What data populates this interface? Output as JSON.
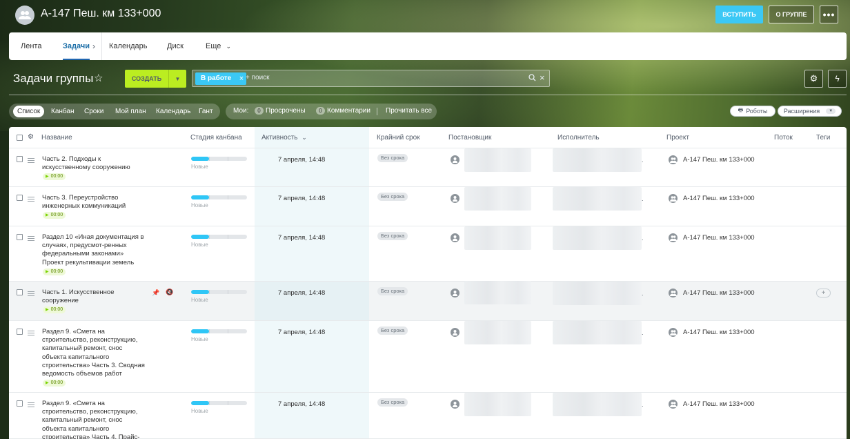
{
  "group": {
    "title": "А-147 Пеш. км 133+000",
    "join_label": "ВСТУПИТЬ",
    "about_label": "О ГРУППЕ",
    "more_label": "•••"
  },
  "nav": {
    "items": [
      "Лента",
      "Задачи",
      "Календарь",
      "Диск",
      "Еще"
    ],
    "active": "Задачи"
  },
  "page": {
    "title": "Задачи группы",
    "create_label": "СОЗДАТЬ"
  },
  "filter": {
    "chip_label": "В работе",
    "placeholder": "+ поиск"
  },
  "views": {
    "items": [
      "Список",
      "Канбан",
      "Сроки",
      "Мой план",
      "Календарь",
      "Гант"
    ],
    "active": "Список"
  },
  "counters": {
    "label": "Мои:",
    "overdue": {
      "count": "0",
      "label": "Просрочены"
    },
    "comments": {
      "count": "0",
      "label": "Комментарии"
    },
    "read_all": "Прочитать все"
  },
  "toolbar": {
    "robots_label": "Роботы",
    "extensions_label": "Расширения"
  },
  "columns": {
    "name": "Название",
    "kanban_stage": "Стадия канбана",
    "activity": "Активность",
    "deadline": "Крайний срок",
    "creator": "Постановщик",
    "responsible": "Исполнитель",
    "project": "Проект",
    "flow": "Поток",
    "tags": "Теги"
  },
  "tasks": [
    {
      "title": "Часть 2. Подходы к искусственному сооружению",
      "timer": "00:00",
      "stage": "Новые",
      "activity": "7 апреля, 14:48",
      "deadline": "Без срока",
      "project": "А-147 Пеш. км 133+000"
    },
    {
      "title": "Часть 3. Переустройство инженерных коммуникаций",
      "timer": "00:00",
      "stage": "Новые",
      "activity": "7 апреля, 14:48",
      "deadline": "Без срока",
      "project": "А-147 Пеш. км 133+000"
    },
    {
      "title": "Раздел 10 «Иная документация в случаях, предусмот-ренных федеральными законами» Проект рекультивации земель",
      "timer": "00:00",
      "stage": "Новые",
      "activity": "7 апреля, 14:48",
      "deadline": "Без срока",
      "project": "А-147 Пеш. км 133+000"
    },
    {
      "title": "Часть 1. Искусственное сооружение",
      "timer": "00:00",
      "stage": "Новые",
      "activity": "7 апреля, 14:48",
      "deadline": "Без срока",
      "project": "А-147 Пеш. км 133+000"
    },
    {
      "title": "Раздел 9. «Смета на строительство, реконструкцию, капитальный ремонт, снос объекта капитального строительства» Часть 3. Сводная ведомость объемов работ",
      "timer": "00:00",
      "stage": "Новые",
      "activity": "7 апреля, 14:48",
      "deadline": "Без срока",
      "project": "А-147 Пеш. км 133+000"
    },
    {
      "title": "Раздел 9. «Смета на строительство, реконструкцию, капитальный ремонт, снос объекта капитального строительства» Часть 4. Прайс-",
      "timer": "",
      "stage": "Новые",
      "activity": "7 апреля, 14:48",
      "deadline": "Без срока",
      "project": "А-147 Пеш. км 133+000"
    }
  ],
  "row_tags_add": "+",
  "colors": {
    "accent": "#3bc8f5",
    "create": "#bbed21",
    "active_tab": "#2066b0"
  }
}
